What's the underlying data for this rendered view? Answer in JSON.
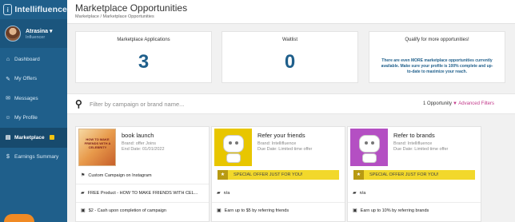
{
  "brand": {
    "logo_letter": "i",
    "name": "Intellifluence"
  },
  "user": {
    "name": "Atrasina",
    "caret": "▾",
    "role": "Influencer"
  },
  "sidebar": {
    "items": [
      {
        "icon": "⌂",
        "label": "Dashboard"
      },
      {
        "icon": "✎",
        "label": "My Offers"
      },
      {
        "icon": "✉",
        "label": "Messages"
      },
      {
        "icon": "☺",
        "label": "My Profile"
      },
      {
        "icon": "▤",
        "label": "Marketplace"
      },
      {
        "icon": "$",
        "label": "Earnings Summary"
      }
    ]
  },
  "header": {
    "title": "Marketplace Opportunities",
    "breadcrumb": "Marketplace  /  Marketplace Opportunities"
  },
  "stats": {
    "applications": {
      "title": "Marketplace Applications",
      "value": "3"
    },
    "waitlist": {
      "title": "Waitlist",
      "value": "0"
    },
    "qualify": {
      "title": "Qualify for more opportunities!",
      "note": "There are even MORE marketplace opportunities currently available. Make sure your profile is 100% complete and up-to-date to maximize your reach."
    }
  },
  "search": {
    "icon": "⚲",
    "placeholder": "Filter by campaign or brand name...",
    "count": "1 Opportunity",
    "filter_icon": "▼",
    "advanced_filters": "Advanced Filters"
  },
  "cards": [
    {
      "image_text": "HOW TO MAKE FRIENDS WITH A CELEBRITY",
      "title": "book launch",
      "brand": "Brand: offer Joins",
      "due": "End Date: 01/01/2022",
      "rows": [
        {
          "icon": "⚑",
          "text": "Custom Campaign on Instagram"
        },
        {
          "icon": "▰",
          "text": "FREE Product - HOW TO MAKE FRIENDS WITH CEL..."
        },
        {
          "icon": "▣",
          "text": "$2 - Cash upon completion of campaign"
        }
      ]
    },
    {
      "title": "Refer your friends",
      "brand": "Brand: Intellifluence",
      "due": "Due Date: Limited time offer",
      "special": "SPECIAL OFFER JUST FOR YOU!",
      "special_icon": "★",
      "rows": [
        {
          "icon": "▰",
          "text": "n/a"
        },
        {
          "icon": "▣",
          "text": "Earn up to $5 by referring friends"
        }
      ]
    },
    {
      "title": "Refer to brands",
      "brand": "Brand: Intellifluence",
      "due": "Due Date: Limited time offer",
      "special": "SPECIAL OFFER JUST FOR YOU!",
      "special_icon": "★",
      "rows": [
        {
          "icon": "▰",
          "text": "n/a"
        },
        {
          "icon": "▣",
          "text": "Earn up to 10% by referring brands"
        }
      ]
    }
  ]
}
